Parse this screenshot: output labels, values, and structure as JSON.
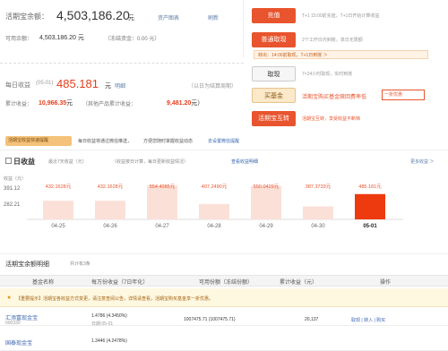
{
  "summary": {
    "balance_label": "活期宝余额：",
    "balance_value": "4,503,186.20",
    "balance_unit": "元",
    "chart_link": "资产图表",
    "refresh_link": "刷新",
    "avail_label": "可用余额：",
    "avail_value": "4,503,186.20",
    "avail_unit": "元",
    "frozen_text": "（冻结资金：0.00 元）"
  },
  "earnings": {
    "daily_label": "每日收益",
    "daily_date": "(05-01)",
    "daily_value": "485.181",
    "daily_unit": "元",
    "detail_link": "明细",
    "settle_note": "（以日为结算周期）",
    "cum_label": "累计收益：",
    "cum_value": "10,966.35",
    "cum_unit": "元",
    "cum_other_label": "（其他产品累计收益：",
    "cum_other_value": "9,481.20",
    "cum_other_unit": "元）"
  },
  "actions": {
    "recharge": "充值",
    "recharge_note": "T+1 15:00前充值，T+1日开始计算收益",
    "regular_redeem": "普通取现",
    "regular_note": "2个工作日内到账，单日无限额",
    "regular_note2": "转出：14:00前取现，T+1日到账 ＞",
    "fast_redeem": "取现",
    "fast_note": "7×24小时取现，实时到账",
    "buy_fund": "买基金",
    "buy_fund_note": "活期宝购买基金赎回费率低",
    "buy_fund_badge": "一折优惠 ",
    "transfer": "活期宝互转",
    "transfer_note": "活期宝互转，享受收益不断档"
  },
  "info_bar": {
    "tag": "活期宝收益快速提醒",
    "text1": "每日收益将通过微信推送，",
    "text2": "方便您随时掌握收益动态",
    "text3": "去设置微信提醒"
  },
  "chart_header": {
    "title": "日收益",
    "sub1": "最近7天收益（元）",
    "sub2": "（收益按日计算，每日更新收益情况）",
    "sub3": "查看收益明细",
    "more": "更多收益 ＞"
  },
  "chart_data": {
    "type": "bar",
    "categories": [
      "04-25",
      "04-26",
      "04-27",
      "04-28",
      "04-29",
      "04-30",
      "05-01"
    ],
    "values": [
      432.1628,
      432.1628,
      554.4085,
      407.249,
      550.0429,
      387.3733,
      485.181
    ],
    "value_labels": [
      "432.1628元",
      "432.1628元",
      "554.4085元",
      "407.2490元",
      "550.0429元",
      "387.3733元",
      "485.181元"
    ],
    "ylabel": "收益（元）",
    "y_ticks": [
      "391.12",
      "282.21"
    ],
    "highlight_index": 6,
    "colors": {
      "bar": "#fbe0d8",
      "highlight": "#ee3a0f",
      "label": "#e8542e"
    }
  },
  "details": {
    "title": "活期宝余额明细",
    "count": "共计有3条",
    "headers": [
      "基金名称",
      "每万份收益（7日年化）",
      "可用份额（冻结份额）",
      "累计收益（元）",
      "操作"
    ],
    "notice": "【重要提示】活期宝各收益方式变更，请注意查阅公告，详情请查看，活期宝购买基金享一折优惠。",
    "rows": [
      {
        "name": "汇添富现金宝",
        "code": "000330",
        "yield": "1.4786 (4.3450%)",
        "yield_sub": "日期:05-01",
        "shares": "1007475.71 (1007475.71)",
        "income": "20,137",
        "ops": "取现 | 转入 | 购买"
      },
      {
        "name": "国泰现金宝",
        "code": "",
        "yield": "1.3446 (4.2478%)",
        "yield_sub": "",
        "shares": "",
        "income": "",
        "ops": ""
      }
    ]
  }
}
